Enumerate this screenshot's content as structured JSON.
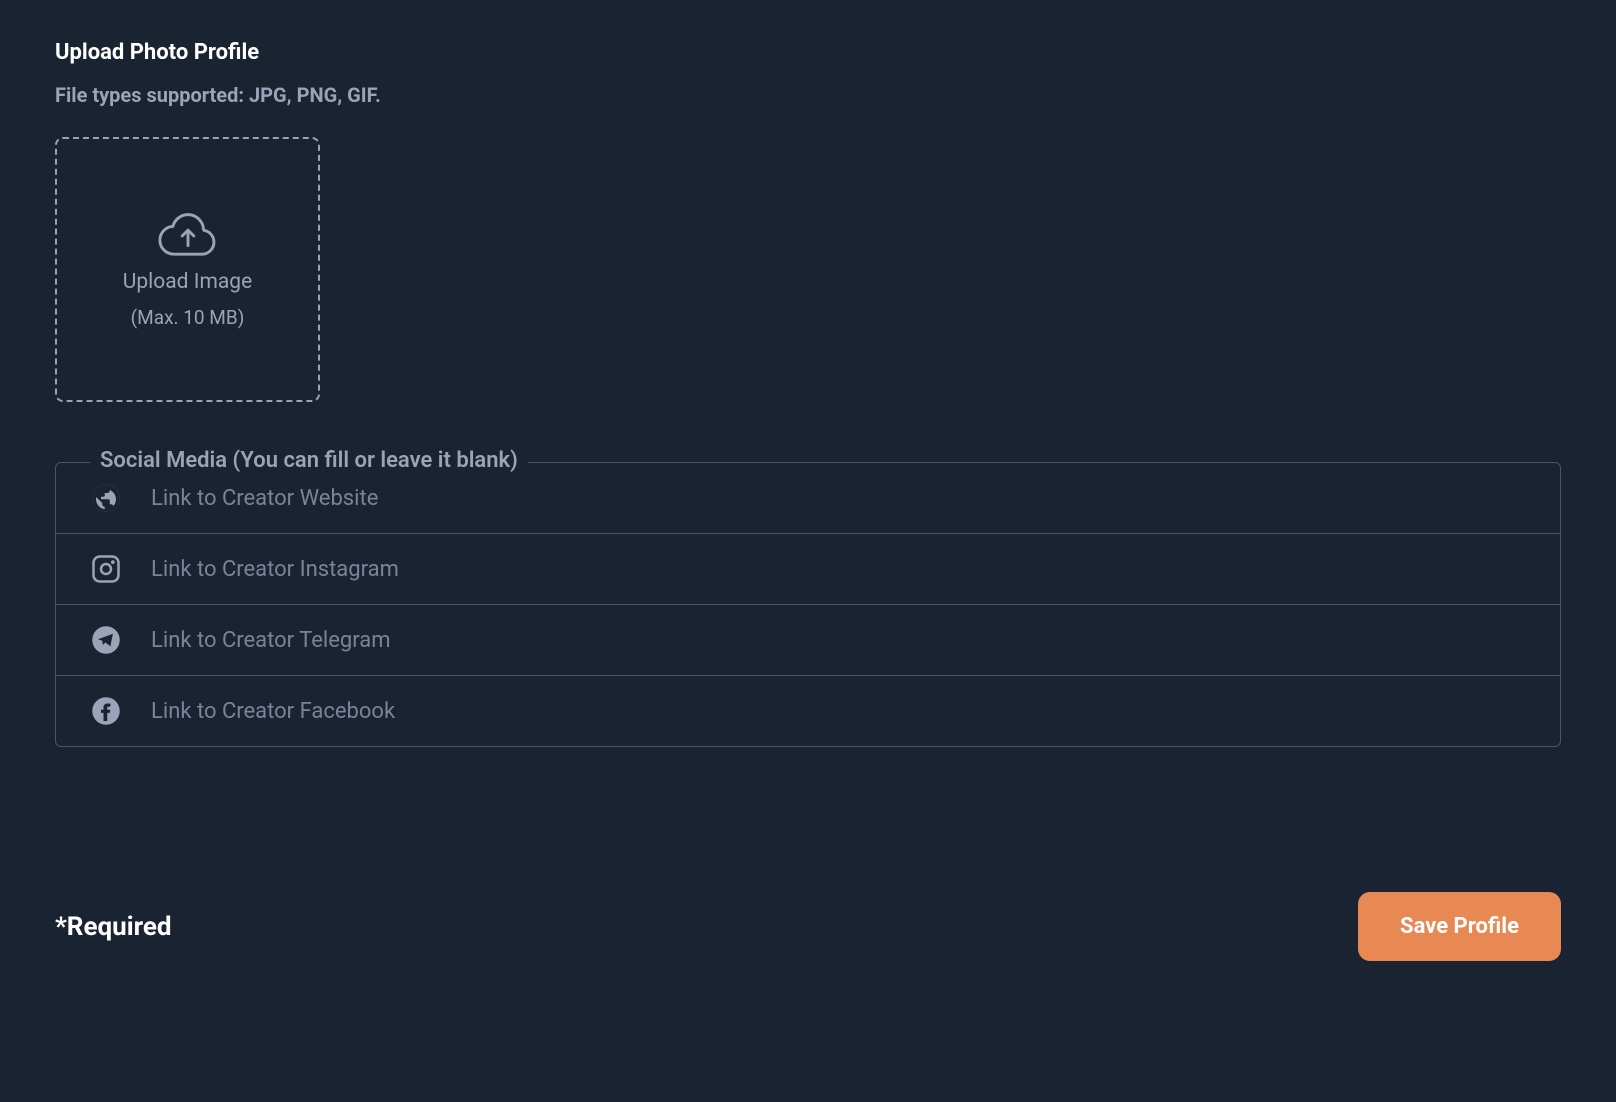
{
  "upload": {
    "title": "Upload Photo Profile",
    "fileTypes": "File types supported: JPG, PNG, GIF.",
    "uploadLabel": "Upload Image",
    "maxSize": "(Max. 10 MB)"
  },
  "socialMedia": {
    "legend": "Social Media (You can fill or leave it blank)",
    "inputs": [
      {
        "icon": "globe",
        "placeholder": "Link to Creator Website"
      },
      {
        "icon": "instagram",
        "placeholder": "Link to Creator Instagram"
      },
      {
        "icon": "telegram",
        "placeholder": "Link to Creator Telegram"
      },
      {
        "icon": "facebook",
        "placeholder": "Link to Creator Facebook"
      }
    ]
  },
  "footer": {
    "requiredText": "*Required",
    "saveButton": "Save Profile"
  }
}
